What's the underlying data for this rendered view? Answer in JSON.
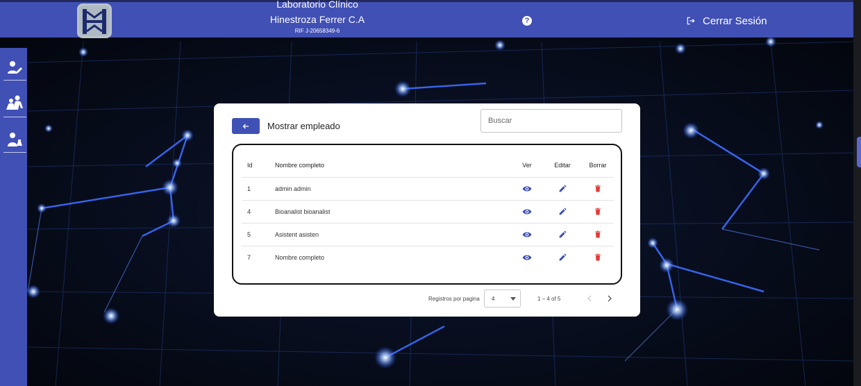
{
  "header": {
    "title_line1": "Laboratorio Clínico",
    "title_line2": "Hinestroza Ferrer C.A",
    "rif": "RIF J-20658349-6",
    "help_glyph": "?",
    "logout_label": "Cerrar Sesión"
  },
  "sidebar": {
    "items": [
      {
        "icon": "user-edit-icon"
      },
      {
        "icon": "users-group-icon"
      },
      {
        "icon": "user-lab-icon"
      }
    ]
  },
  "card": {
    "title": "Mostrar empleado",
    "search_placeholder": "Buscar",
    "columns": {
      "id": "Id",
      "name": "Nombre completo",
      "view": "Ver",
      "edit": "Editar",
      "delete": "Borrar"
    },
    "rows": [
      {
        "id": "1",
        "name": "admin admin"
      },
      {
        "id": "4",
        "name": "Bioanalist bioanalist"
      },
      {
        "id": "5",
        "name": "Asistent asisten"
      },
      {
        "id": "7",
        "name": "Nombre completo"
      }
    ],
    "pagination": {
      "rows_per_page_label": "Registros por pagina",
      "rows_per_page_value": "4",
      "range": "1 – 4 of 5"
    }
  },
  "colors": {
    "primary": "#4150b5",
    "view_icon": "#3f51b5",
    "edit_icon": "#3f51b5",
    "delete_icon": "#e53935"
  }
}
